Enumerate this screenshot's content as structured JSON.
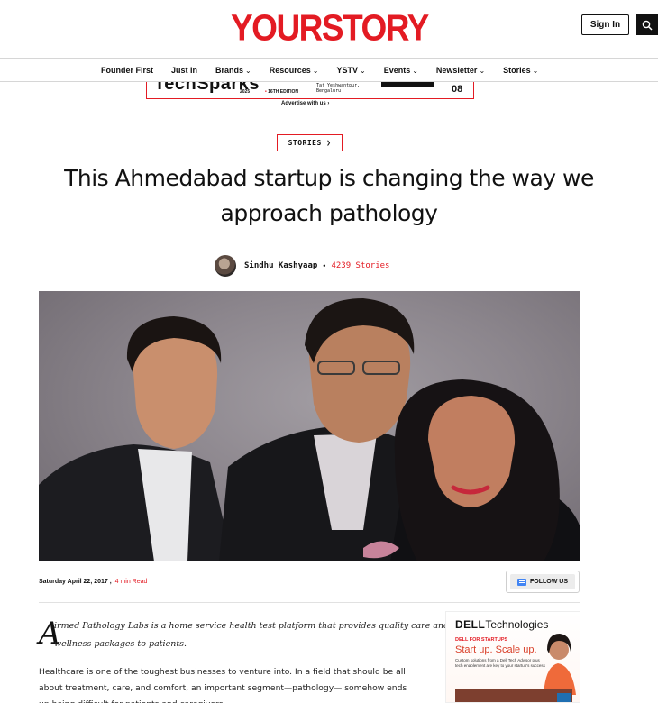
{
  "header": {
    "logo": "YOURSTORY",
    "sign_in": "Sign In",
    "search_icon": "search-icon",
    "brand_color": "#e31b23"
  },
  "nav": {
    "items": [
      {
        "label": "Founder First",
        "dropdown": false
      },
      {
        "label": "Just In",
        "dropdown": false
      },
      {
        "label": "Brands",
        "dropdown": true
      },
      {
        "label": "Resources",
        "dropdown": true
      },
      {
        "label": "YSTV",
        "dropdown": true
      },
      {
        "label": "Events",
        "dropdown": true
      },
      {
        "label": "Newsletter",
        "dropdown": true
      },
      {
        "label": "Stories",
        "dropdown": true
      }
    ]
  },
  "ad_banner": {
    "brand": "TechSparks",
    "year": "2025",
    "edition": "16TH EDITION",
    "venue_line1": "Taj Yeshwantpur,",
    "venue_line2": "Bengaluru",
    "date": "08",
    "advertise_label": "Advertise with us"
  },
  "article": {
    "category": "STORIES",
    "title": "This Ahmedabad startup is changing the way we approach pathology",
    "author": "Sindhu Kashyaap",
    "author_stories": "4239 Stories",
    "date": "Saturday April 22, 2017 ,",
    "read_time": "4 min Read",
    "follow_label": "FOLLOW US",
    "dropcap": "A",
    "lead_line1": "irmed Pathology Labs is a home service health test platform that provides quality care and",
    "lead_line2": "wellness packages to patients.",
    "body": "Healthcare is one of the toughest businesses to venture into. In a field that should be all about treatment, care, and comfort, an important segment—pathology— somehow ends up being difficult for patients and caregivers."
  },
  "side_ad": {
    "logo_bold": "DELL",
    "logo_rest": "Technologies",
    "tag": "DELL FOR STARTUPS",
    "headline": "Start up. Scale up.",
    "copy": "Custom solutions from a Dell Tech Advisor plus tech enablement are key to your startup's success"
  }
}
